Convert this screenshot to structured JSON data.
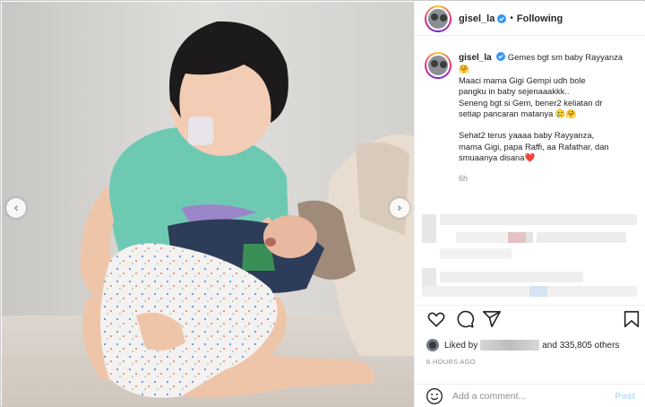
{
  "post": {
    "username": "gisel_la",
    "separator": "•",
    "follow_status": "Following",
    "caption_lines": [
      "Gemes bgt sm baby Rayyanza",
      "🤗",
      "Maaci mama Gigi Gempi udh bole",
      "pangku in baby sejenaaakkk..",
      "Seneng bgt si Gem, bener2 keliatan dr",
      "setiap pancaran matanya 🥲🤗",
      "Sehat2 terus yaaaa baby Rayyanza,",
      "mama Gigi, papa Raffi, aa Rafathar, dan",
      "smuaanya disana❤️"
    ],
    "caption_time": "6h",
    "likes_prefix": "Liked by",
    "likes_suffix": "and 335,805 others",
    "posted_ago": "6 HOURS AGO",
    "comment_placeholder": "Add a comment...",
    "post_label": "Post"
  },
  "nav": {
    "prev": "‹",
    "next": "›"
  },
  "icons": [
    "heart-icon",
    "comment-icon",
    "share-icon",
    "bookmark-icon",
    "emoji-icon",
    "verified-badge-icon",
    "chevron-left-icon",
    "chevron-right-icon"
  ],
  "colors": {
    "verified": "#3897f0",
    "post_button": "#b2dffc",
    "meta_text": "#8e8e8e"
  }
}
